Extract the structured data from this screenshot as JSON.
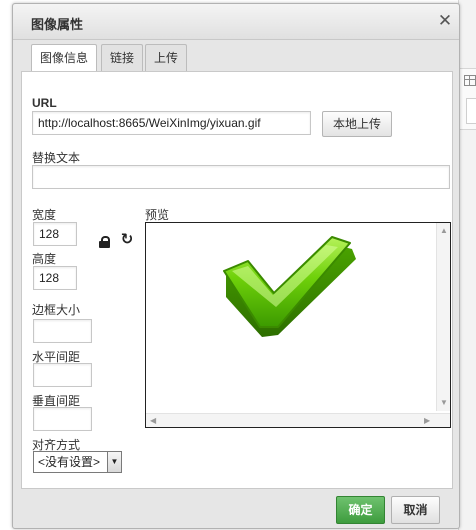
{
  "dialog": {
    "title": "图像属性",
    "close_symbol": "✕"
  },
  "tabs": [
    {
      "label": "图像信息",
      "active": true
    },
    {
      "label": "链接",
      "active": false
    },
    {
      "label": "上传",
      "active": false
    }
  ],
  "url": {
    "label": "URL",
    "value": "http://localhost:8665/WeiXinImg/yixuan.gif",
    "upload_button": "本地上传"
  },
  "alt_text": {
    "label": "替换文本",
    "value": ""
  },
  "width": {
    "label": "宽度",
    "value": "128"
  },
  "height": {
    "label": "高度",
    "value": "128"
  },
  "border": {
    "label": "边框大小",
    "value": ""
  },
  "hspace": {
    "label": "水平间距",
    "value": ""
  },
  "vspace": {
    "label": "垂直间距",
    "value": ""
  },
  "align": {
    "label": "对齐方式",
    "selected": "<没有设置>"
  },
  "preview": {
    "label": "预览",
    "image_icon": "green-checkmark-icon"
  },
  "icons": {
    "lock": "lock-icon",
    "reset": "reset-size-icon",
    "close": "close-icon"
  },
  "footer": {
    "ok_label": "确定",
    "cancel_label": "取消"
  },
  "colors": {
    "ok_button": "#4aa84a",
    "check_mark": "#5fd100"
  }
}
